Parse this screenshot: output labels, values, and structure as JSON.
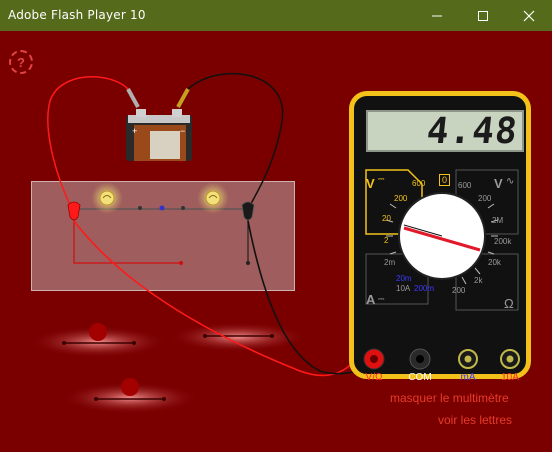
{
  "window": {
    "title": "Adobe Flash Player 10",
    "minimize_icon": "minimize-icon",
    "maximize_icon": "maximize-icon",
    "close_icon": "close-icon"
  },
  "help": {
    "label": "?"
  },
  "multimeter": {
    "display_value": "4.48",
    "dc_volt_label": "V",
    "ac_volt_label": "V",
    "amp_label": "A",
    "ohm_label": "Ω",
    "dc_volt_ranges": [
      "600",
      "200",
      "20",
      "2"
    ],
    "ac_volt_ranges": [
      "600",
      "200"
    ],
    "amp_ranges": [
      "2m",
      "20m",
      "200m",
      "10A"
    ],
    "ohm_ranges": [
      "2M",
      "200k",
      "20k",
      "2k",
      "200"
    ],
    "off_label": "0",
    "jacks": [
      {
        "label": "V/Ω",
        "color": "#ff2a2a"
      },
      {
        "label": "COM",
        "color": "#ffffff"
      },
      {
        "label": "mA",
        "color": "#3a3aff"
      },
      {
        "label": "10A",
        "color": "#ff2a2a"
      }
    ]
  },
  "links": {
    "hide_multimeter": "masquer le multimètre",
    "show_letters": "voir les lettres"
  },
  "battery": {
    "plus": "+",
    "minus": "−"
  },
  "colors": {
    "stage": "#7a0000",
    "titlebar": "#556a1a",
    "multimeter_frame": "#f3c21a",
    "red_wire": "#ff1a1a",
    "black_wire": "#151515"
  }
}
